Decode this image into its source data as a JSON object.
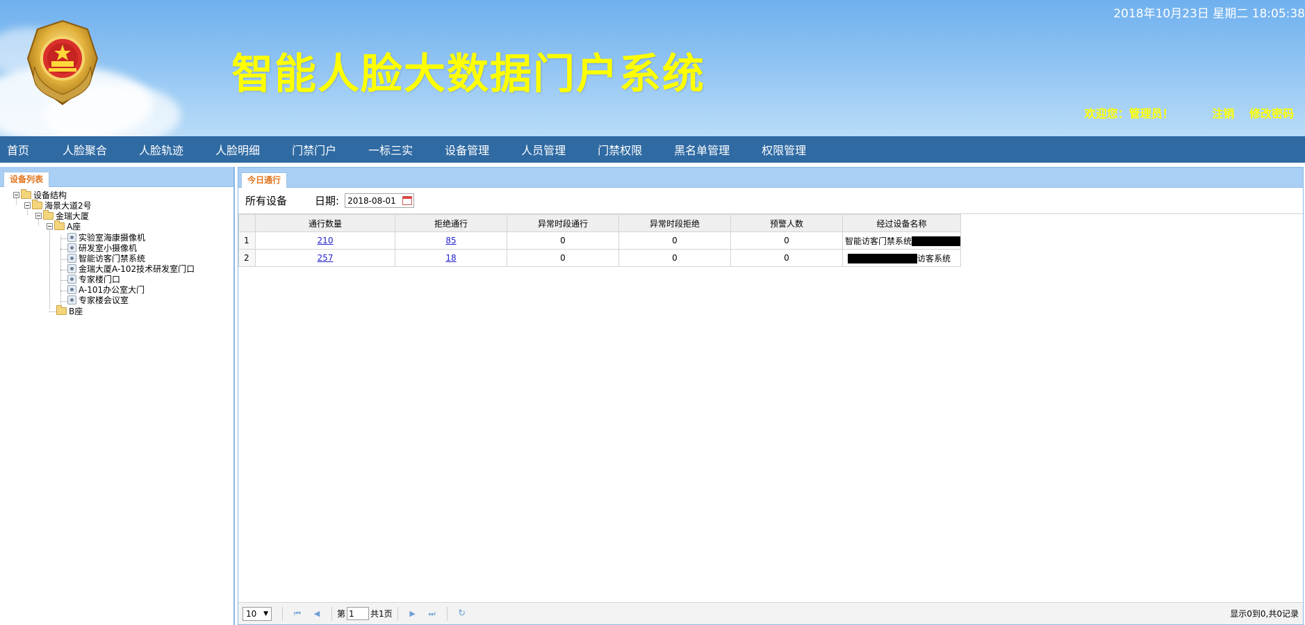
{
  "header": {
    "title": "智能人脸大数据门户系统",
    "datetime": "2018年10月23日 星期二 18:05:38",
    "welcome": "欢迎您：管理员！",
    "logout": "注销",
    "change_password": "修改密码",
    "colors": {
      "title": "#ffff00",
      "nav_bg": "#2f6aa3"
    }
  },
  "nav": [
    "首页",
    "人脸聚合",
    "人脸轨迹",
    "人脸明细",
    "门禁门户",
    "一标三实",
    "设备管理",
    "人员管理",
    "门禁权限",
    "黑名单管理",
    "权限管理"
  ],
  "left_panel": {
    "tab": "设备列表",
    "tree": {
      "root": "设备结构",
      "address": "海景大道2号",
      "building": "金瑞大厦",
      "block_a": "A座",
      "devices": [
        "实验室海康摄像机",
        "研发室小摄像机",
        "智能访客门禁系统",
        "金瑞大厦A-102技术研发室门口",
        "专家楼门口",
        "A-101办公室大门",
        "专家楼会议室"
      ],
      "block_b": "B座"
    }
  },
  "main_panel": {
    "tab": "今日通行",
    "filter": {
      "all_devices": "所有设备",
      "date_label": "日期:",
      "date_value": "2018-08-01"
    },
    "columns": [
      "通行数量",
      "拒绝通行",
      "异常时段通行",
      "异常时段拒绝",
      "预警人数",
      "经过设备名称"
    ],
    "rows": [
      {
        "no": "1",
        "pass": "210",
        "reject": "85",
        "abn_pass": "0",
        "abn_reject": "0",
        "alert": "0",
        "device": "智能访客门禁系统"
      },
      {
        "no": "2",
        "pass": "257",
        "reject": "18",
        "abn_pass": "0",
        "abn_reject": "0",
        "alert": "0",
        "device": "访客系统"
      }
    ],
    "pager": {
      "page_size": "10",
      "page_prefix": "第",
      "page_value": "1",
      "page_total": "共1页",
      "info": "显示0到0,共0记录"
    }
  }
}
